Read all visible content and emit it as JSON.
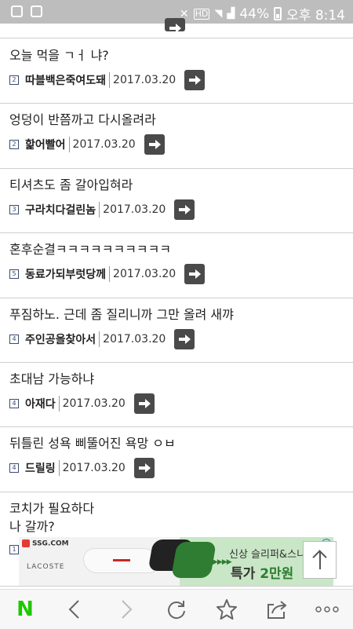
{
  "status_bar": {
    "battery_text": "44%",
    "time": "오후 8:14",
    "hd_label": "HD"
  },
  "posts": [
    {
      "title": "오늘 먹을 ㄱㅓ 냐?",
      "badge": "2",
      "author": "따블백은죽여도돼",
      "date": "2017.03.20"
    },
    {
      "title": "엉덩이 반쯤까고 다시올려라",
      "badge": "2",
      "author": "핥어빨어",
      "date": "2017.03.20"
    },
    {
      "title": "티셔츠도 좀 갈아입혀라",
      "badge": "3",
      "author": "구라치다걸린놈",
      "date": "2017.03.20"
    },
    {
      "title": "혼후순결ㅋㅋㅋㅋㅋㅋㅋㅋㅋㅋ",
      "badge": "5",
      "author": "동료가되부럿당께",
      "date": "2017.03.20"
    },
    {
      "title": "푸짐하노. 근데 좀 질리니까 그만 올려 새꺄",
      "badge": "4",
      "author": "주인공을찾아서",
      "date": "2017.03.20"
    },
    {
      "title": "초대남 가능하냐",
      "badge": "4",
      "author": "아재다",
      "date": "2017.03.20"
    },
    {
      "title": "뒤틀린 성욕 삐뚤어진 욕망 ㅇㅂ",
      "badge": "4",
      "author": "드릴링",
      "date": "2017.03.20"
    },
    {
      "title": "코치가 필요하다\n나 갈까?",
      "badge": "1",
      "author": "",
      "date": ""
    }
  ],
  "ad": {
    "ssg_label": "SSG.COM",
    "brand": "LACOSTE",
    "line1": "신상 슬리퍼&스니",
    "line2_prefix": "특가 ",
    "line2_highlight": "2만원",
    "info": "i",
    "arrows": "▶▶▶▶"
  },
  "toolbar": {
    "home_label": "N"
  },
  "colors": {
    "naver_green": "#1ec800",
    "status_bar": "#bdbdbd",
    "arrow_button": "#4a4a4a"
  }
}
